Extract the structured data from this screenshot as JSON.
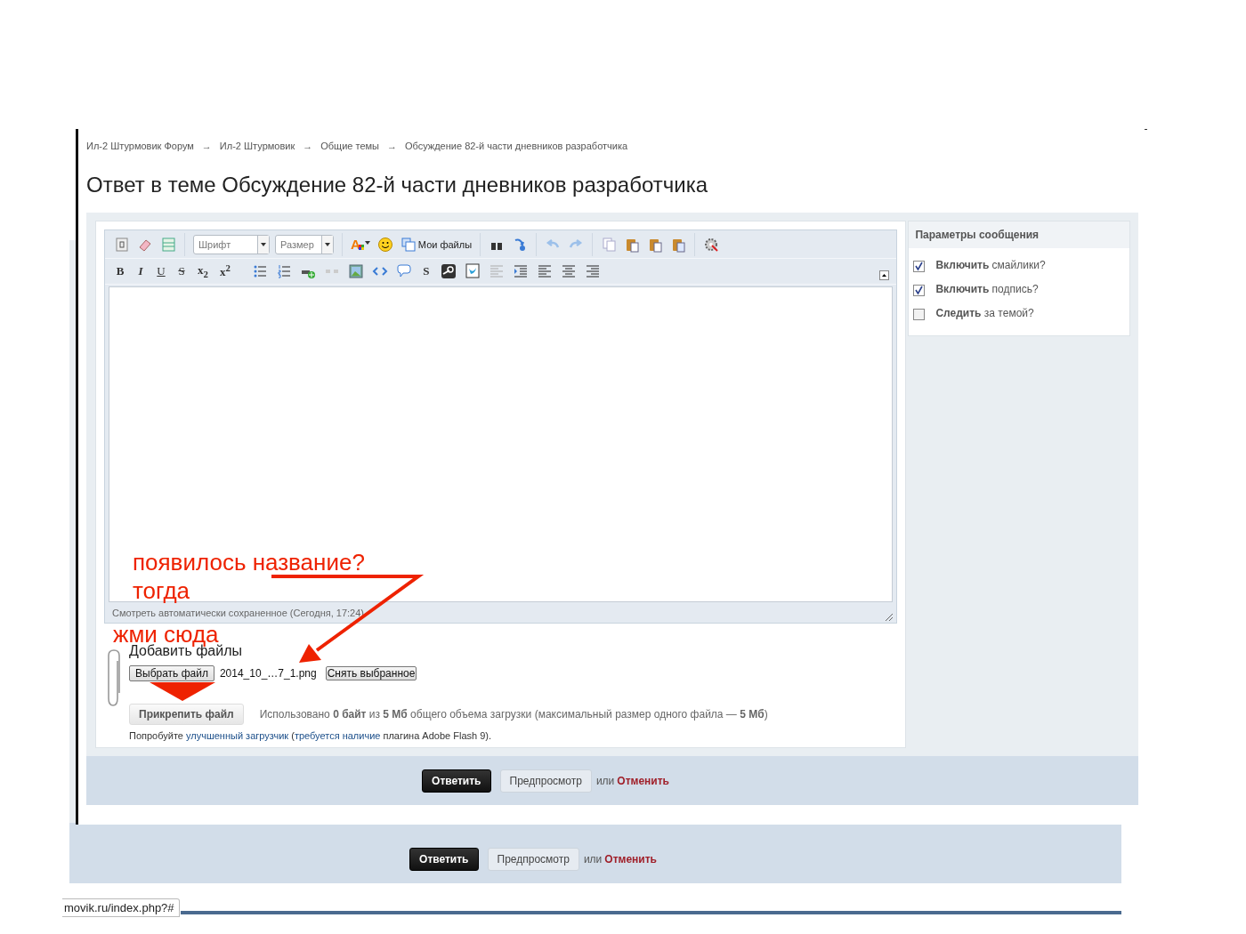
{
  "breadcrumbs": [
    "Ил-2 Штурмовик Форум",
    "Ил-2 Штурмовик",
    "Общие темы",
    "Обсуждение 82-й части дневников разработчика"
  ],
  "breadcrumb_separator": "→",
  "title": "Ответ в теме Обсуждение 82-й части дневников разработчика",
  "toolbar": {
    "font_placeholder": "Шрифт",
    "size_placeholder": "Размер",
    "color_button": "A",
    "my_files": "Мои файлы",
    "format_buttons": [
      {
        "kind": "bold",
        "label": "B"
      },
      {
        "kind": "italic",
        "label": "I"
      },
      {
        "kind": "underline",
        "label": "U"
      },
      {
        "kind": "strike",
        "label": "S"
      },
      {
        "kind": "sub",
        "label": "x$_{2}$"
      },
      {
        "kind": "sup",
        "label": "x$^{2}$"
      }
    ],
    "spoiler_button": "S"
  },
  "editor": {
    "autosave_link": "Смотреть автоматически сохраненное (Сегодня, 17:24)"
  },
  "options": {
    "title": "Параметры сообщения",
    "items": [
      {
        "label": "**Включить** смайлики?",
        "checked": true
      },
      {
        "label": "**Включить** подпись?",
        "checked": true
      },
      {
        "label": "**Следить** за темой?",
        "checked": false
      }
    ]
  },
  "attachments": {
    "title": "Добавить файлы",
    "choose_button": "Выбрать файл",
    "file_name": "2014_10_…7_1.png",
    "clear_button": "Снять выбранное",
    "attach_button": "Прикрепить файл",
    "usage": "Использовано **0 байт** из **5 Мб** общего объема загрузки (максимальный размер одного файла — **5 Мб**)",
    "uploader_hint": [
      {
        "text": "Попробуйте ",
        "link": false
      },
      {
        "text": "улучшенный загрузчик",
        "link": true
      },
      {
        "text": " (",
        "link": false
      },
      {
        "text": "требуется наличие",
        "link": true
      },
      {
        "text": " плагина Adobe Flash 9).",
        "link": false
      }
    ]
  },
  "form_actions": {
    "submit": "Ответить",
    "preview": "Предпросмотр",
    "or": "или",
    "cancel": "Отменить"
  },
  "background_page": {
    "form_actions": {
      "submit": "Ответить",
      "preview": "Предпросмотр",
      "or": "или",
      "cancel": "Отменить"
    },
    "status_url": "movik.ru/index.php?#"
  },
  "annotations": [
    "появилось название?",
    "тогда",
    "жми сюда"
  ]
}
